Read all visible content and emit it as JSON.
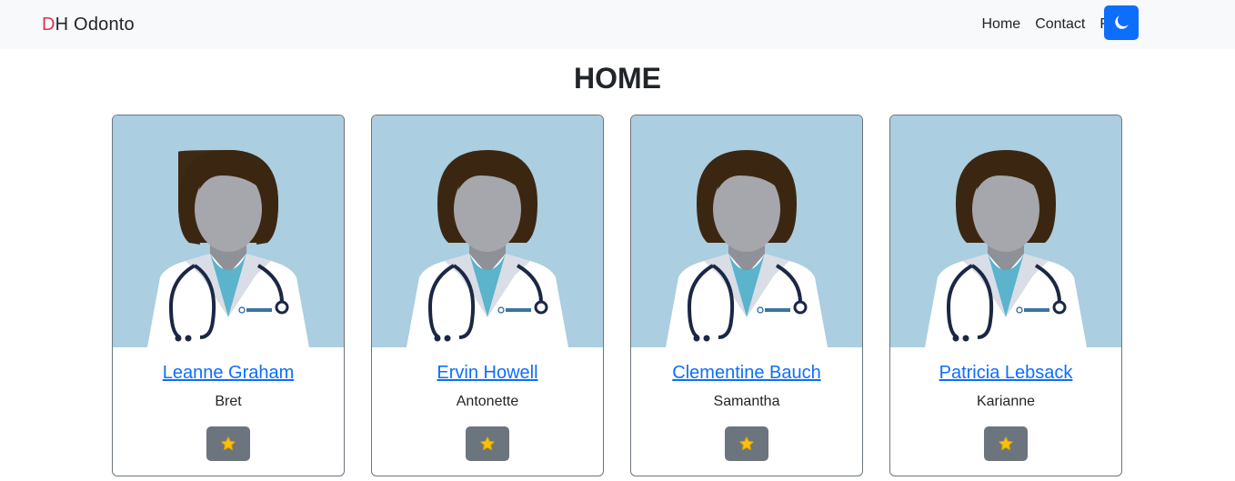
{
  "navbar": {
    "brand_first": "D",
    "brand_rest": "H Odonto",
    "links": [
      "Home",
      "Contact",
      "Favs"
    ],
    "theme_icon": "moon-icon"
  },
  "page": {
    "title": "HOME"
  },
  "cards": [
    {
      "name": "Leanne Graham",
      "username": "Bret",
      "fav_icon": "star-icon"
    },
    {
      "name": "Ervin Howell",
      "username": "Antonette",
      "fav_icon": "star-icon"
    },
    {
      "name": "Clementine Bauch",
      "username": "Samantha",
      "fav_icon": "star-icon"
    },
    {
      "name": "Patricia Lebsack",
      "username": "Karianne",
      "fav_icon": "star-icon"
    }
  ],
  "colors": {
    "accent": "#0d6efd",
    "brand_letter": "#dc3545",
    "navbar_bg": "#f8f9fa",
    "card_image_bg": "#abcee0",
    "fav_button_bg": "#6c757d",
    "star": "#ffc107"
  }
}
